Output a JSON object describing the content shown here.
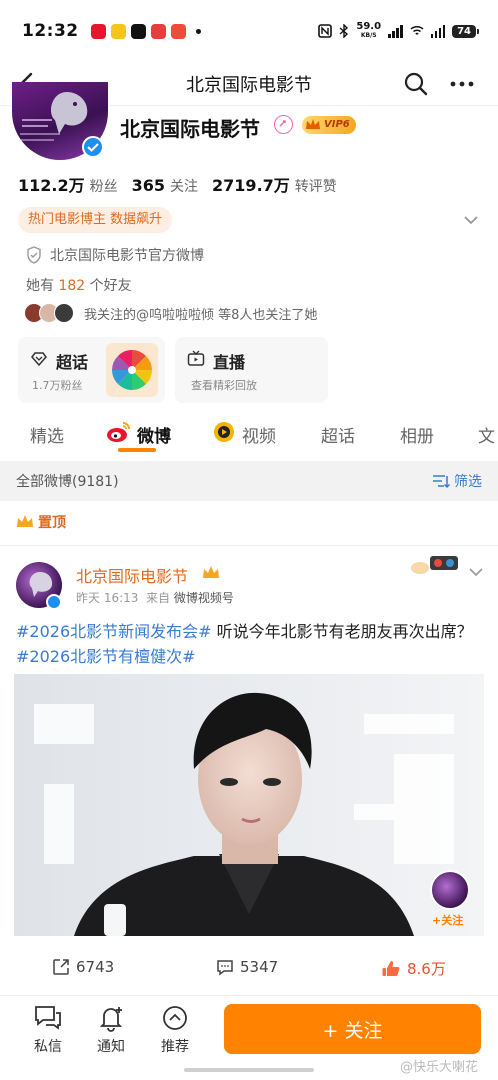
{
  "status_bar": {
    "time": "12:32",
    "network_speed": "59.0",
    "network_unit": "KB/S",
    "battery": "74"
  },
  "nav": {
    "title": "北京国际电影节"
  },
  "profile": {
    "name": "北京国际电影节",
    "vip_label": "VIP6",
    "stats": [
      {
        "value": "112.2万",
        "label": "粉丝"
      },
      {
        "value": "365",
        "label": "关注"
      },
      {
        "value": "2719.7万",
        "label": "转评赞"
      }
    ],
    "hot_tag": "热门电影博主 数据飙升",
    "verified": "北京国际电影节官方微博",
    "friends_prefix": "她有",
    "friends_count": "182",
    "friends_suffix": "个好友",
    "mutual_text": "我关注的@呜啦啦啦倾 等8人也关注了她"
  },
  "cards": {
    "super": {
      "title": "超话",
      "sub": "1.7万粉丝"
    },
    "live": {
      "title": "直播",
      "sub": "查看精彩回放"
    }
  },
  "tabs": [
    "精选",
    "微博",
    "视频",
    "超话",
    "相册",
    "文"
  ],
  "active_tab": "微博",
  "filter": {
    "all_label": "全部微博(9181)",
    "filter_label": "筛选"
  },
  "pinned_label": "置顶",
  "post": {
    "author": "北京国际电影节",
    "time": "昨天 16:13",
    "from_prefix": "来自",
    "source": "微博视频号",
    "text_parts": [
      {
        "type": "tag",
        "text": "#2026北影节新闻发布会#"
      },
      {
        "type": "text",
        "text": " 听说今年北影节有老朋友再次出席？"
      },
      {
        "type": "tag",
        "text": "#2026北影节有檀健次#"
      }
    ],
    "image_follow": "+关注",
    "reposts": "6743",
    "comments": "5347",
    "likes": "8.6万"
  },
  "bottom_bar": {
    "message": "私信",
    "notify": "通知",
    "recommend": "推荐",
    "follow": "+ 关注",
    "watermark": "@快乐大喇花"
  },
  "colors": {
    "accent_orange": "#ff8200",
    "name_orange": "#e06a1f",
    "link_blue": "#3a7bd5",
    "verify_blue": "#1e8ff0"
  }
}
